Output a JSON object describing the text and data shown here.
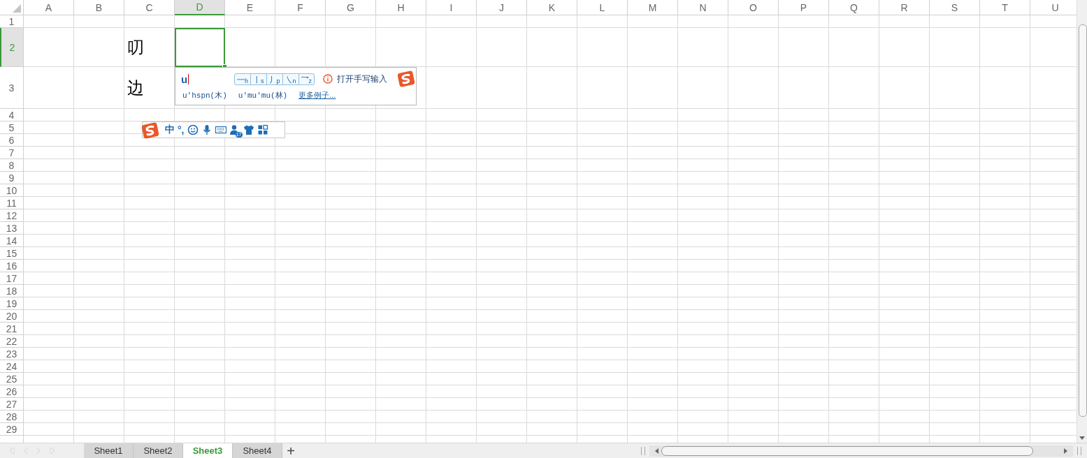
{
  "columns": [
    {
      "label": "A",
      "selected": false
    },
    {
      "label": "B",
      "selected": false
    },
    {
      "label": "C",
      "selected": false
    },
    {
      "label": "D",
      "selected": true
    },
    {
      "label": "E",
      "selected": false
    },
    {
      "label": "F",
      "selected": false
    },
    {
      "label": "G",
      "selected": false
    },
    {
      "label": "H",
      "selected": false
    },
    {
      "label": "I",
      "selected": false
    },
    {
      "label": "J",
      "selected": false
    },
    {
      "label": "K",
      "selected": false
    },
    {
      "label": "L",
      "selected": false
    },
    {
      "label": "M",
      "selected": false
    },
    {
      "label": "N",
      "selected": false
    },
    {
      "label": "O",
      "selected": false
    },
    {
      "label": "P",
      "selected": false
    },
    {
      "label": "Q",
      "selected": false
    },
    {
      "label": "R",
      "selected": false
    },
    {
      "label": "S",
      "selected": false
    },
    {
      "label": "T",
      "selected": false
    },
    {
      "label": "U",
      "selected": false
    }
  ],
  "rows": [
    {
      "label": "1",
      "selected": false
    },
    {
      "label": "2",
      "selected": true,
      "cells": [
        null,
        null,
        {
          "text": "叨",
          "selected": false
        },
        {
          "selected": true
        }
      ]
    },
    {
      "label": "3",
      "selected": false,
      "cells": [
        null,
        null,
        {
          "text": "边",
          "selected": false
        }
      ]
    },
    {
      "label": "4",
      "selected": false
    },
    {
      "label": "5",
      "selected": false
    },
    {
      "label": "6",
      "selected": false
    },
    {
      "label": "7",
      "selected": false
    },
    {
      "label": "8",
      "selected": false
    },
    {
      "label": "9",
      "selected": false
    },
    {
      "label": "10",
      "selected": false
    },
    {
      "label": "11",
      "selected": false
    },
    {
      "label": "12",
      "selected": false
    },
    {
      "label": "13",
      "selected": false
    },
    {
      "label": "14",
      "selected": false
    },
    {
      "label": "15",
      "selected": false
    },
    {
      "label": "16",
      "selected": false
    },
    {
      "label": "17",
      "selected": false
    },
    {
      "label": "18",
      "selected": false
    },
    {
      "label": "19",
      "selected": false
    },
    {
      "label": "20",
      "selected": false
    },
    {
      "label": "21",
      "selected": false
    },
    {
      "label": "22",
      "selected": false
    },
    {
      "label": "23",
      "selected": false
    },
    {
      "label": "24",
      "selected": false
    },
    {
      "label": "25",
      "selected": false
    },
    {
      "label": "26",
      "selected": false
    },
    {
      "label": "27",
      "selected": false
    },
    {
      "label": "28",
      "selected": false
    },
    {
      "label": "29",
      "selected": false
    }
  ],
  "ime_candidates": {
    "input": "u",
    "stroke_keys": [
      {
        "stroke": "一",
        "letter": "h"
      },
      {
        "stroke": "丨",
        "letter": "s"
      },
      {
        "stroke": "丿",
        "letter": "p"
      },
      {
        "stroke": "㇏",
        "letter": "n"
      },
      {
        "stroke": "乛",
        "letter": "z"
      }
    ],
    "handwriting_link": "打开手写输入",
    "examples": [
      "u'hspn(木)",
      "u'mu'mu(林)"
    ],
    "more_link": "更多例子..."
  },
  "ime_toolbar": {
    "mode": "中",
    "punctuation": "°,",
    "badge": "17"
  },
  "sheet_tabs": [
    {
      "label": "Sheet1",
      "selected": false
    },
    {
      "label": "Sheet2",
      "selected": false
    },
    {
      "label": "Sheet3",
      "selected": true
    },
    {
      "label": "Sheet4",
      "selected": false
    }
  ],
  "add_sheet": "+"
}
